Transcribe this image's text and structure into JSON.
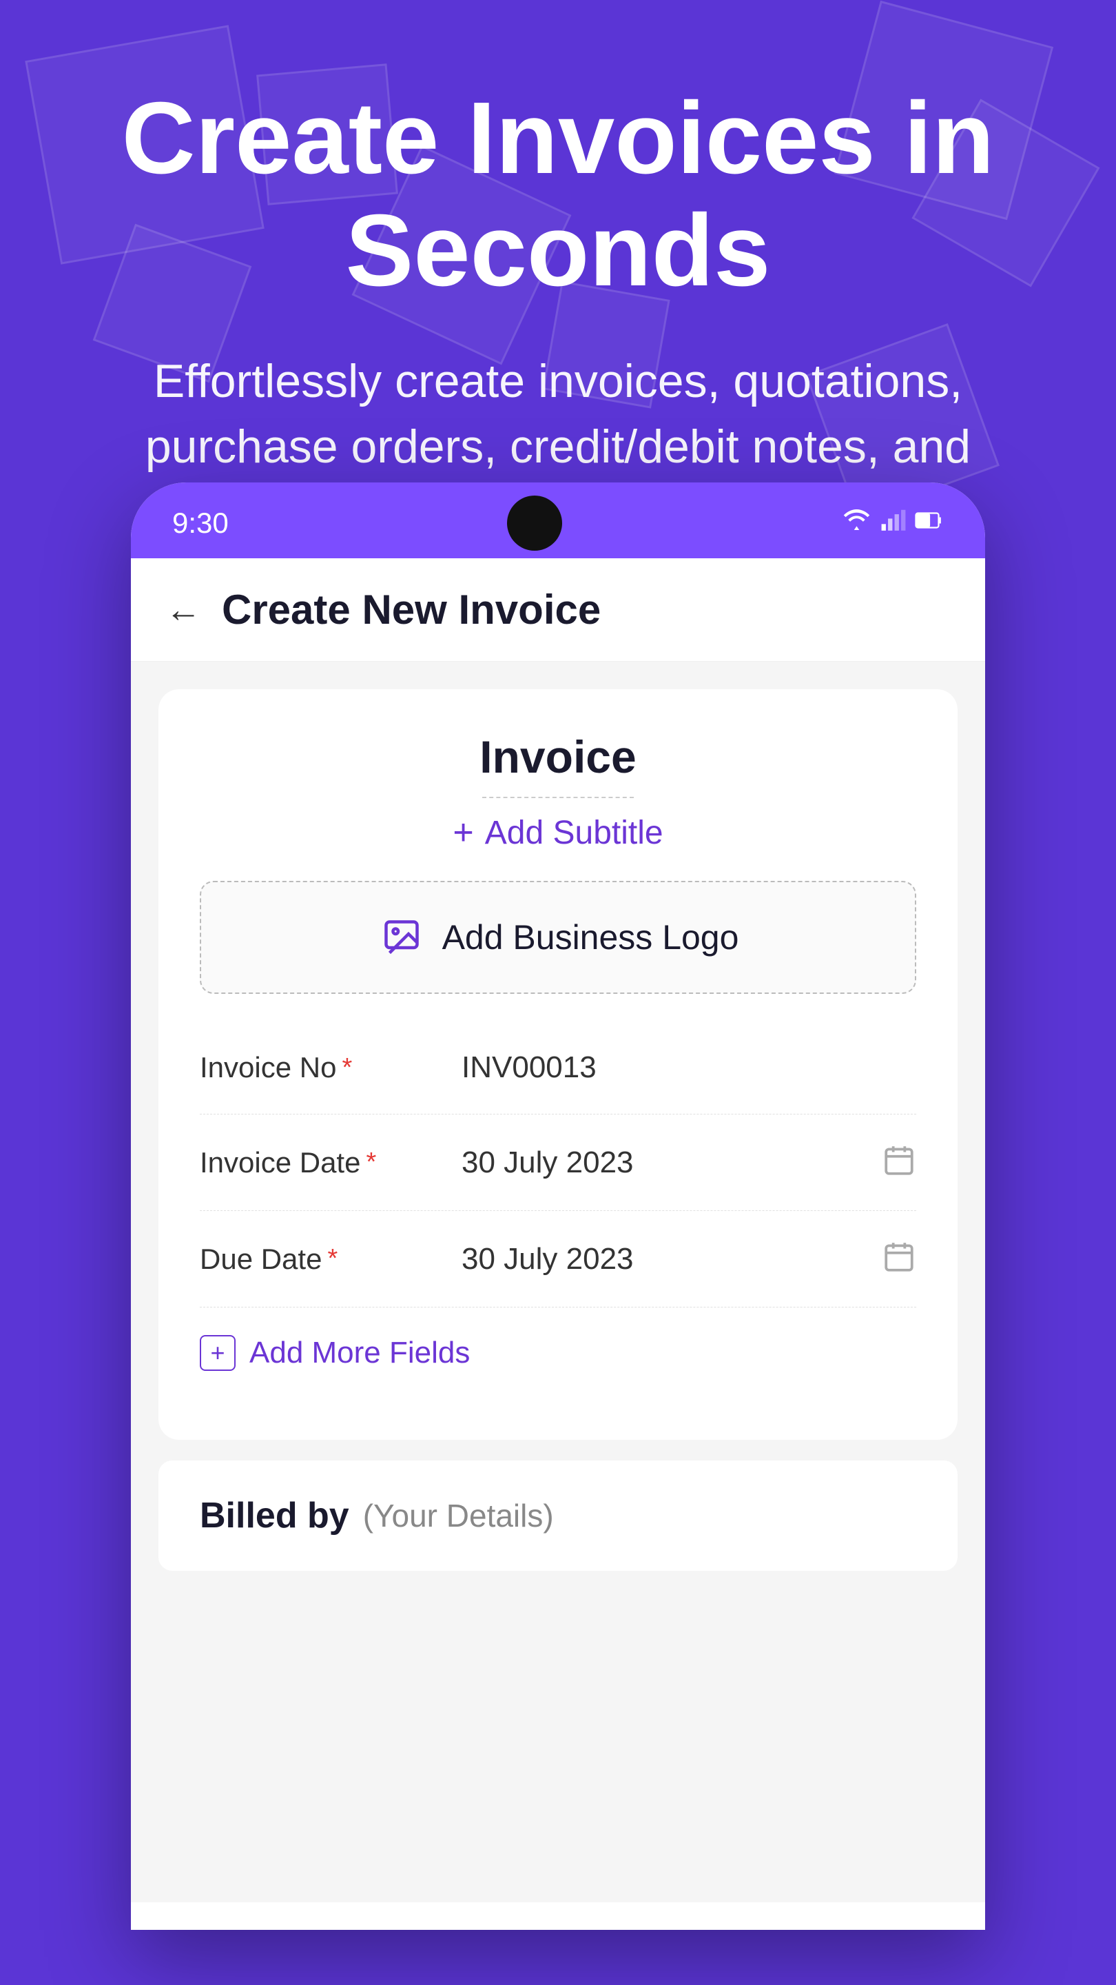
{
  "hero": {
    "title": "Create Invoices in Seconds",
    "subtitle": "Effortlessly create invoices, quotations, purchase orders, credit/debit notes, and more."
  },
  "status_bar": {
    "time": "9:30",
    "wifi_icon": "▼",
    "signal_icon": "◂",
    "battery_icon": "▯"
  },
  "app_header": {
    "back_icon": "←",
    "title": "Create New Invoice"
  },
  "invoice_form": {
    "invoice_title": "Invoice",
    "add_subtitle_label": "Add Subtitle",
    "add_logo_label": "Add Business Logo",
    "fields": [
      {
        "label": "Invoice No",
        "value": "INV00013",
        "has_calendar": false
      },
      {
        "label": "Invoice Date",
        "value": "30 July 2023",
        "has_calendar": true
      },
      {
        "label": "Due Date",
        "value": "30 July 2023",
        "has_calendar": true
      }
    ],
    "add_more_fields_label": "Add More Fields",
    "billed_by_label": "Billed by",
    "billed_by_subtitle": "(Your Details)"
  }
}
